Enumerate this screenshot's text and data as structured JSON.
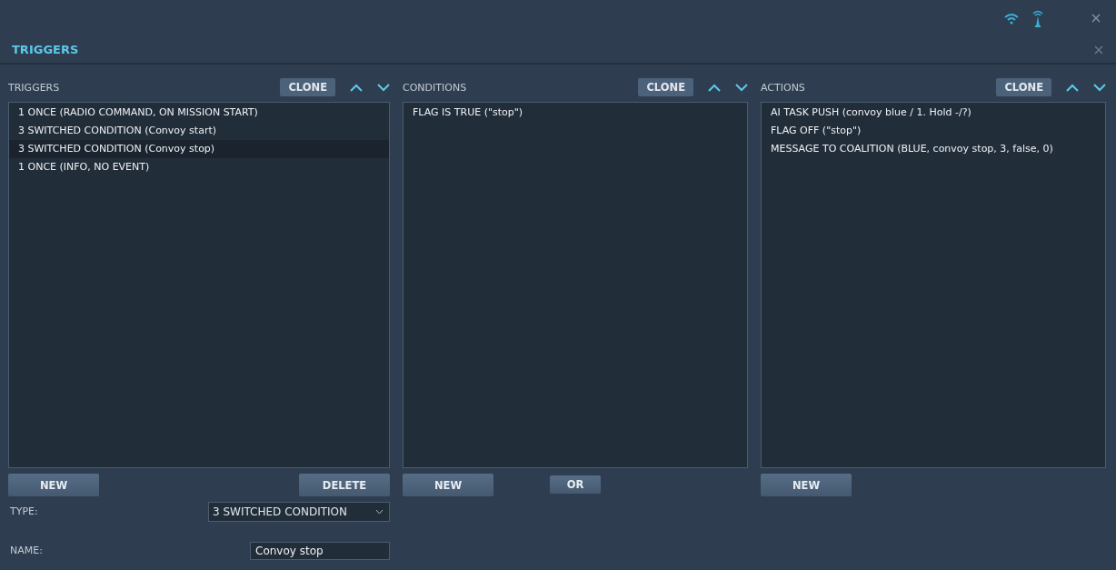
{
  "window": {
    "title": "TRIGGERS"
  },
  "panels": [
    {
      "title": "TRIGGERS",
      "clone": "CLONE",
      "items": [
        {
          "text": "1 ONCE (RADIO COMMAND, ON MISSION START)",
          "selected": false
        },
        {
          "text": "3 SWITCHED CONDITION (Convoy start)",
          "selected": false
        },
        {
          "text": "3 SWITCHED CONDITION (Convoy stop)",
          "selected": true
        },
        {
          "text": "1 ONCE (INFO, NO EVENT)",
          "selected": false
        }
      ],
      "buttons": [
        {
          "label": "NEW",
          "kind": "wide"
        },
        {
          "label": "DELETE",
          "kind": "wide"
        }
      ]
    },
    {
      "title": "CONDITIONS",
      "clone": "CLONE",
      "items": [
        {
          "text": "FLAG IS TRUE (\"stop\")",
          "selected": false
        }
      ],
      "buttons": [
        {
          "label": "NEW",
          "kind": "wide"
        },
        {
          "label": "OR",
          "kind": "small"
        }
      ]
    },
    {
      "title": "ACTIONS",
      "clone": "CLONE",
      "items": [
        {
          "text": "AI TASK PUSH (convoy blue / 1. Hold -/?)",
          "selected": false
        },
        {
          "text": "FLAG OFF (\"stop\")",
          "selected": false
        },
        {
          "text": "MESSAGE TO COALITION (BLUE, convoy stop, 3, false, 0)",
          "selected": false
        }
      ],
      "buttons": [
        {
          "label": "NEW",
          "kind": "wide"
        }
      ]
    }
  ],
  "type": {
    "label": "TYPE:",
    "value": "3 SWITCHED CONDITION"
  },
  "name": {
    "label": "NAME:",
    "value": "Convoy stop"
  }
}
